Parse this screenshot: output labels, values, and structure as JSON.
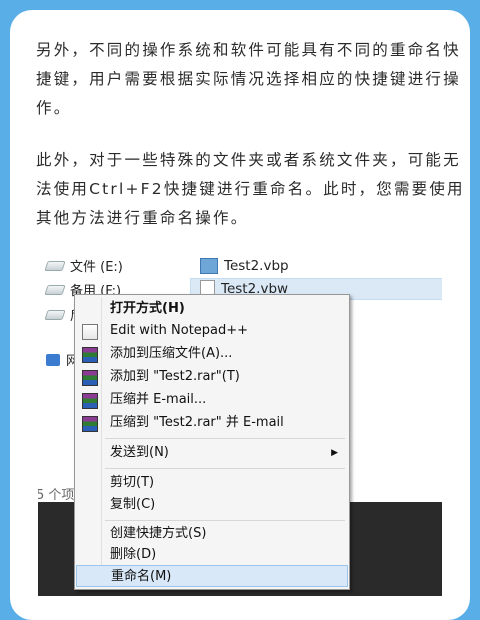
{
  "article": {
    "paragraph1": "另外，不同的操作系统和软件可能具有不同的重命名快捷键，用户需要根据实际情况选择相应的快捷键进行操作。",
    "paragraph2": "此外，对于一些特殊的文件夹或者系统文件夹，可能无法使用Ctrl+F2快捷键进行重命名。此时，您需要使用其他方法进行重命名操作。"
  },
  "explorer": {
    "tree": [
      "文件 (E:)",
      "备用 (F:)",
      "后",
      "网"
    ],
    "files": [
      "Test2.vbp",
      "Test2.vbw"
    ],
    "item_count": "5 个项"
  },
  "context_menu": {
    "items": [
      {
        "label": "打开方式(H)",
        "icon": "none"
      },
      {
        "label": "Edit with Notepad++",
        "icon": "notepad-icon"
      },
      {
        "label": "添加到压缩文件(A)...",
        "icon": "winrar-icon"
      },
      {
        "label": "添加到 \"Test2.rar\"(T)",
        "icon": "winrar-icon"
      },
      {
        "label": "压缩并 E-mail...",
        "icon": "winrar-icon"
      },
      {
        "label": "压缩到 \"Test2.rar\" 并 E-mail",
        "icon": "winrar-icon"
      },
      {
        "label": "发送到(N)",
        "icon": "none"
      },
      {
        "label": "剪切(T)",
        "icon": "none"
      },
      {
        "label": "复制(C)",
        "icon": "none"
      },
      {
        "label": "创建快捷方式(S)",
        "icon": "none"
      },
      {
        "label": "删除(D)",
        "icon": "none"
      },
      {
        "label": "重命名(M)",
        "icon": "none"
      }
    ]
  },
  "colors": {
    "background": "#5aaee8",
    "highlight": "#d9e8f8"
  }
}
